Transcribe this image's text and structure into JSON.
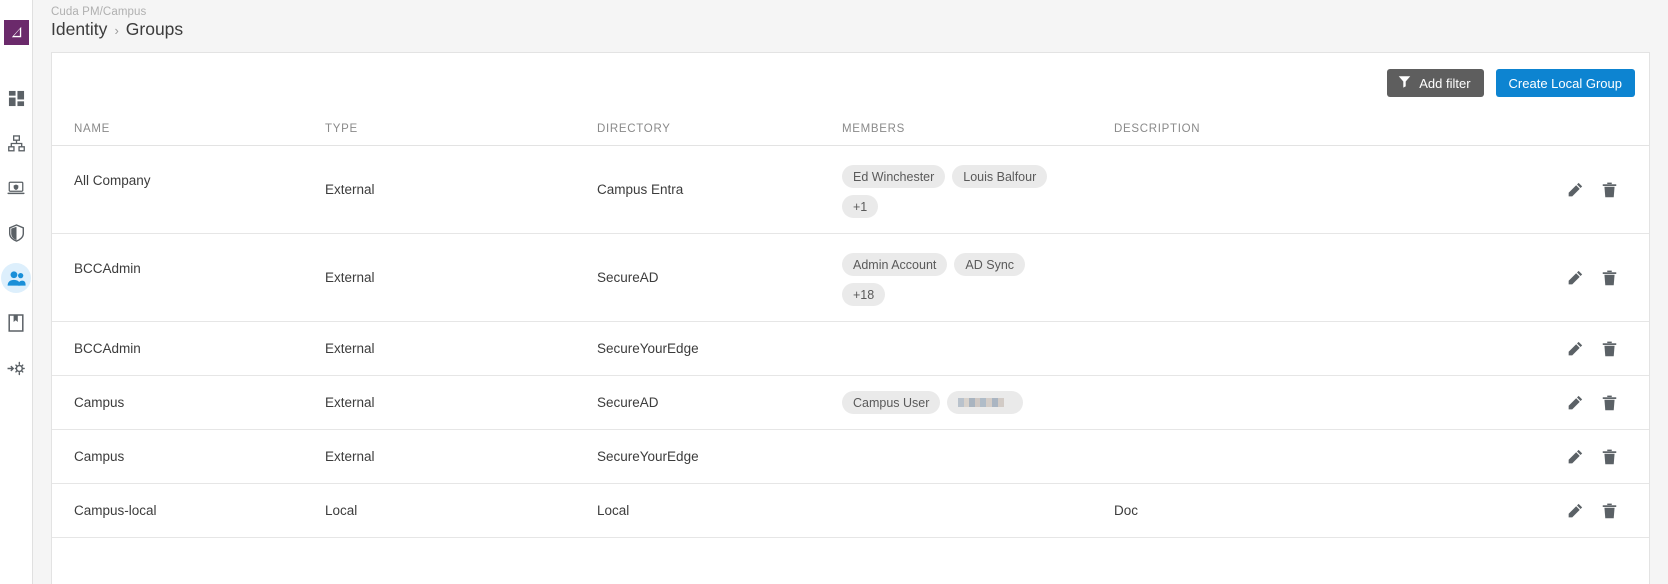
{
  "breadcrumb": {
    "tenant": "Cuda PM/Campus",
    "section": "Identity",
    "separator": "›",
    "page": "Groups"
  },
  "sidebar": {
    "logo_name": "barracuda-logo",
    "items": [
      {
        "name": "dashboard",
        "icon": "dashboard-grid-icon",
        "active": false
      },
      {
        "name": "network",
        "icon": "org-hierarchy-icon",
        "active": false
      },
      {
        "name": "endpoint",
        "icon": "laptop-security-icon",
        "active": false
      },
      {
        "name": "security",
        "icon": "shield-icon",
        "active": false
      },
      {
        "name": "identity",
        "icon": "users-icon",
        "active": true
      },
      {
        "name": "logs",
        "icon": "book-icon",
        "active": false
      },
      {
        "name": "settings",
        "icon": "gear-deploy-icon",
        "active": false
      }
    ]
  },
  "toolbar": {
    "add_filter_label": "Add filter",
    "add_filter_icon": "funnel-icon",
    "create_label": "Create Local Group"
  },
  "colors": {
    "accent_blue": "#0d84d1",
    "filter_gray": "#5e5e5e",
    "logo_purple": "#6b2a6b",
    "active_nav": "#1a8fd8"
  },
  "table": {
    "columns": [
      "NAME",
      "TYPE",
      "DIRECTORY",
      "MEMBERS",
      "DESCRIPTION"
    ],
    "rows": [
      {
        "name": "All Company",
        "type": "External",
        "directory": "Campus Entra",
        "members": [
          "Ed Winchester",
          "Louis Balfour",
          "+1"
        ],
        "redacted": [],
        "description": "",
        "tall": true
      },
      {
        "name": "BCCAdmin",
        "type": "External",
        "directory": "SecureAD",
        "members": [
          "Admin Account",
          "AD Sync",
          "+18"
        ],
        "redacted": [],
        "description": "",
        "tall": true
      },
      {
        "name": "BCCAdmin",
        "type": "External",
        "directory": "SecureYourEdge",
        "members": [],
        "redacted": [],
        "description": "",
        "tall": false
      },
      {
        "name": "Campus",
        "type": "External",
        "directory": "SecureAD",
        "members": [
          "Campus User",
          "██████"
        ],
        "redacted": [
          1
        ],
        "description": "",
        "tall": false
      },
      {
        "name": "Campus",
        "type": "External",
        "directory": "SecureYourEdge",
        "members": [],
        "redacted": [],
        "description": "",
        "tall": false
      },
      {
        "name": "Campus-local",
        "type": "Local",
        "directory": "Local",
        "members": [],
        "redacted": [],
        "description": "Doc",
        "tall": false
      }
    ],
    "row_actions": [
      {
        "name": "edit-row-button",
        "icon": "pencil-icon"
      },
      {
        "name": "delete-row-button",
        "icon": "trash-icon"
      }
    ]
  }
}
